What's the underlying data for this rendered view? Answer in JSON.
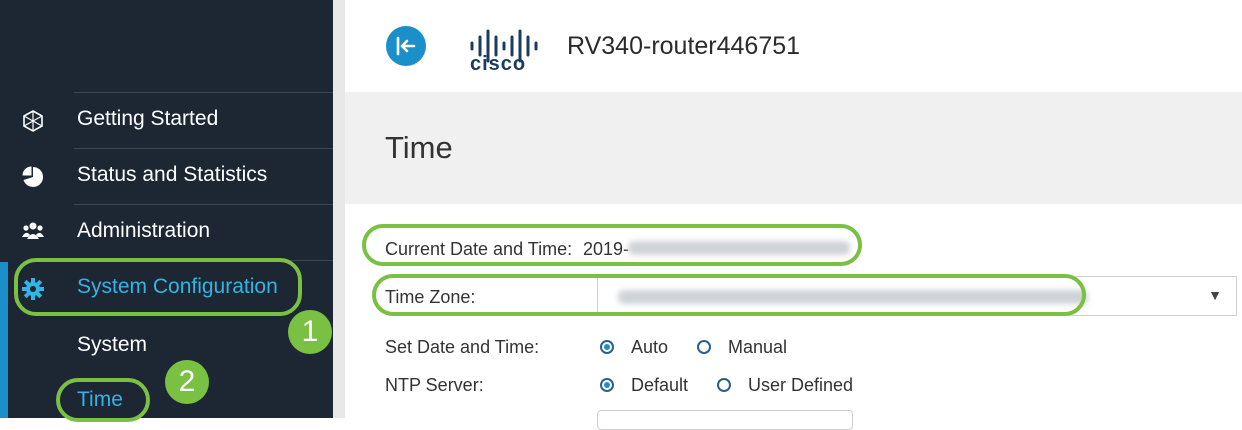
{
  "header": {
    "logo_text": "cisco",
    "device_name": "RV340-router446751"
  },
  "sidebar": {
    "items": [
      {
        "label": "Getting Started",
        "icon": "globe-icon"
      },
      {
        "label": "Status and Statistics",
        "icon": "pie-chart-icon"
      },
      {
        "label": "Administration",
        "icon": "users-icon"
      },
      {
        "label": "System Configuration",
        "icon": "gear-icon"
      }
    ],
    "subitems": [
      {
        "label": "System"
      },
      {
        "label": "Time",
        "selected": true
      }
    ]
  },
  "annotations": {
    "step1": "1",
    "step2": "2",
    "highlight_color": "#7ac043"
  },
  "page": {
    "title": "Time"
  },
  "form": {
    "current_datetime_label": "Current Date and Time:",
    "current_datetime_value": "2019-",
    "timezone_label": "Time Zone:",
    "set_datetime_label": "Set Date and Time:",
    "set_datetime_options": [
      "Auto",
      "Manual"
    ],
    "set_datetime_selected": "Auto",
    "ntp_label": "NTP Server:",
    "ntp_options": [
      "Default",
      "User Defined"
    ],
    "ntp_selected": "Default"
  },
  "colors": {
    "sidebar_bg": "#1c2733",
    "accent": "#1b8fc9",
    "selected_text": "#34b3e4"
  }
}
